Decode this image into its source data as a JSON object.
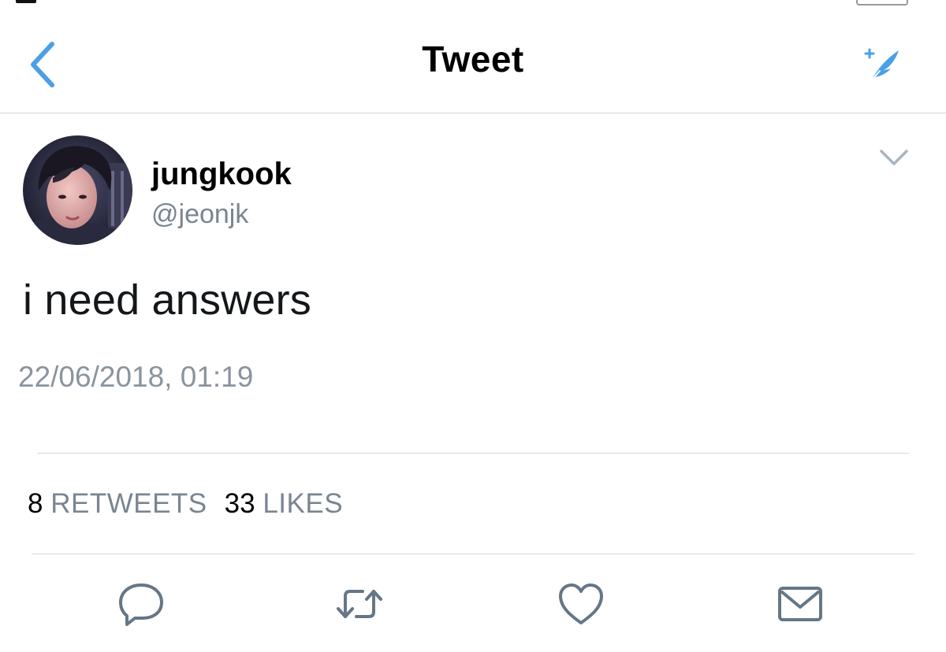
{
  "nav": {
    "title": "Tweet",
    "back_icon": "chevron-left-icon",
    "compose_icon": "compose-feather-icon",
    "accent_color": "#4a9fe6"
  },
  "tweet": {
    "author": {
      "display_name": "jungkook",
      "handle": "@jeonjk"
    },
    "text": "i need answers",
    "timestamp": "22/06/2018, 01:19",
    "more_icon": "chevron-down-icon"
  },
  "stats": {
    "retweets_count": "8",
    "retweets_label": "RETWEETS",
    "likes_count": "33",
    "likes_label": "LIKES"
  },
  "actions": [
    {
      "icon": "reply-icon"
    },
    {
      "icon": "retweet-icon"
    },
    {
      "icon": "heart-icon"
    },
    {
      "icon": "envelope-icon"
    }
  ],
  "colors": {
    "icon_gray": "#657786",
    "text_secondary": "#7a8591",
    "divider": "#d5d9dd"
  }
}
